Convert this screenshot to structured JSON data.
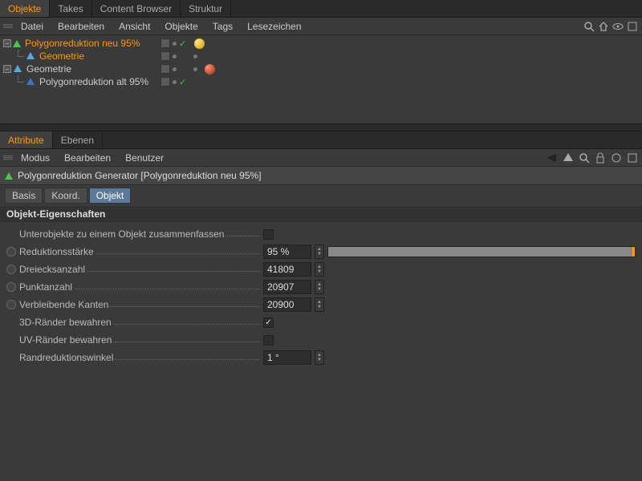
{
  "top_tabs": [
    "Objekte",
    "Takes",
    "Content Browser",
    "Struktur"
  ],
  "top_tabs_active": 0,
  "obj_menu": [
    "Datei",
    "Bearbeiten",
    "Ansicht",
    "Objekte",
    "Tags",
    "Lesezeichen"
  ],
  "tree": {
    "r1": "Polygonreduktion neu 95%",
    "r2": "Geometrie",
    "r3": "Geometrie",
    "r4": "Polygonreduktion alt 95%"
  },
  "attr_tabs": [
    "Attribute",
    "Ebenen"
  ],
  "attr_tabs_active": 0,
  "attr_menu": [
    "Modus",
    "Bearbeiten",
    "Benutzer"
  ],
  "object_title": "Polygonreduktion Generator [Polygonreduktion neu 95%]",
  "mode_tabs": [
    "Basis",
    "Koord.",
    "Objekt"
  ],
  "mode_tabs_active": 2,
  "section": "Objekt-Eigenschaften",
  "props": {
    "merge_label": "Unterobjekte zu einem Objekt zusammenfassen",
    "merge_checked": false,
    "strength_label": "Reduktionsstärke",
    "strength_value": "95 %",
    "tris_label": "Dreiecksanzahl",
    "tris_value": "41809",
    "pts_label": "Punktanzahl",
    "pts_value": "20907",
    "edges_label": "Verbleibende Kanten",
    "edges_value": "20900",
    "preserve3d_label": "3D-Ränder bewahren",
    "preserve3d_checked": true,
    "preserveUV_label": "UV-Ränder bewahren",
    "preserveUV_checked": false,
    "angle_label": "Randreduktionswinkel",
    "angle_value": "1 °"
  }
}
